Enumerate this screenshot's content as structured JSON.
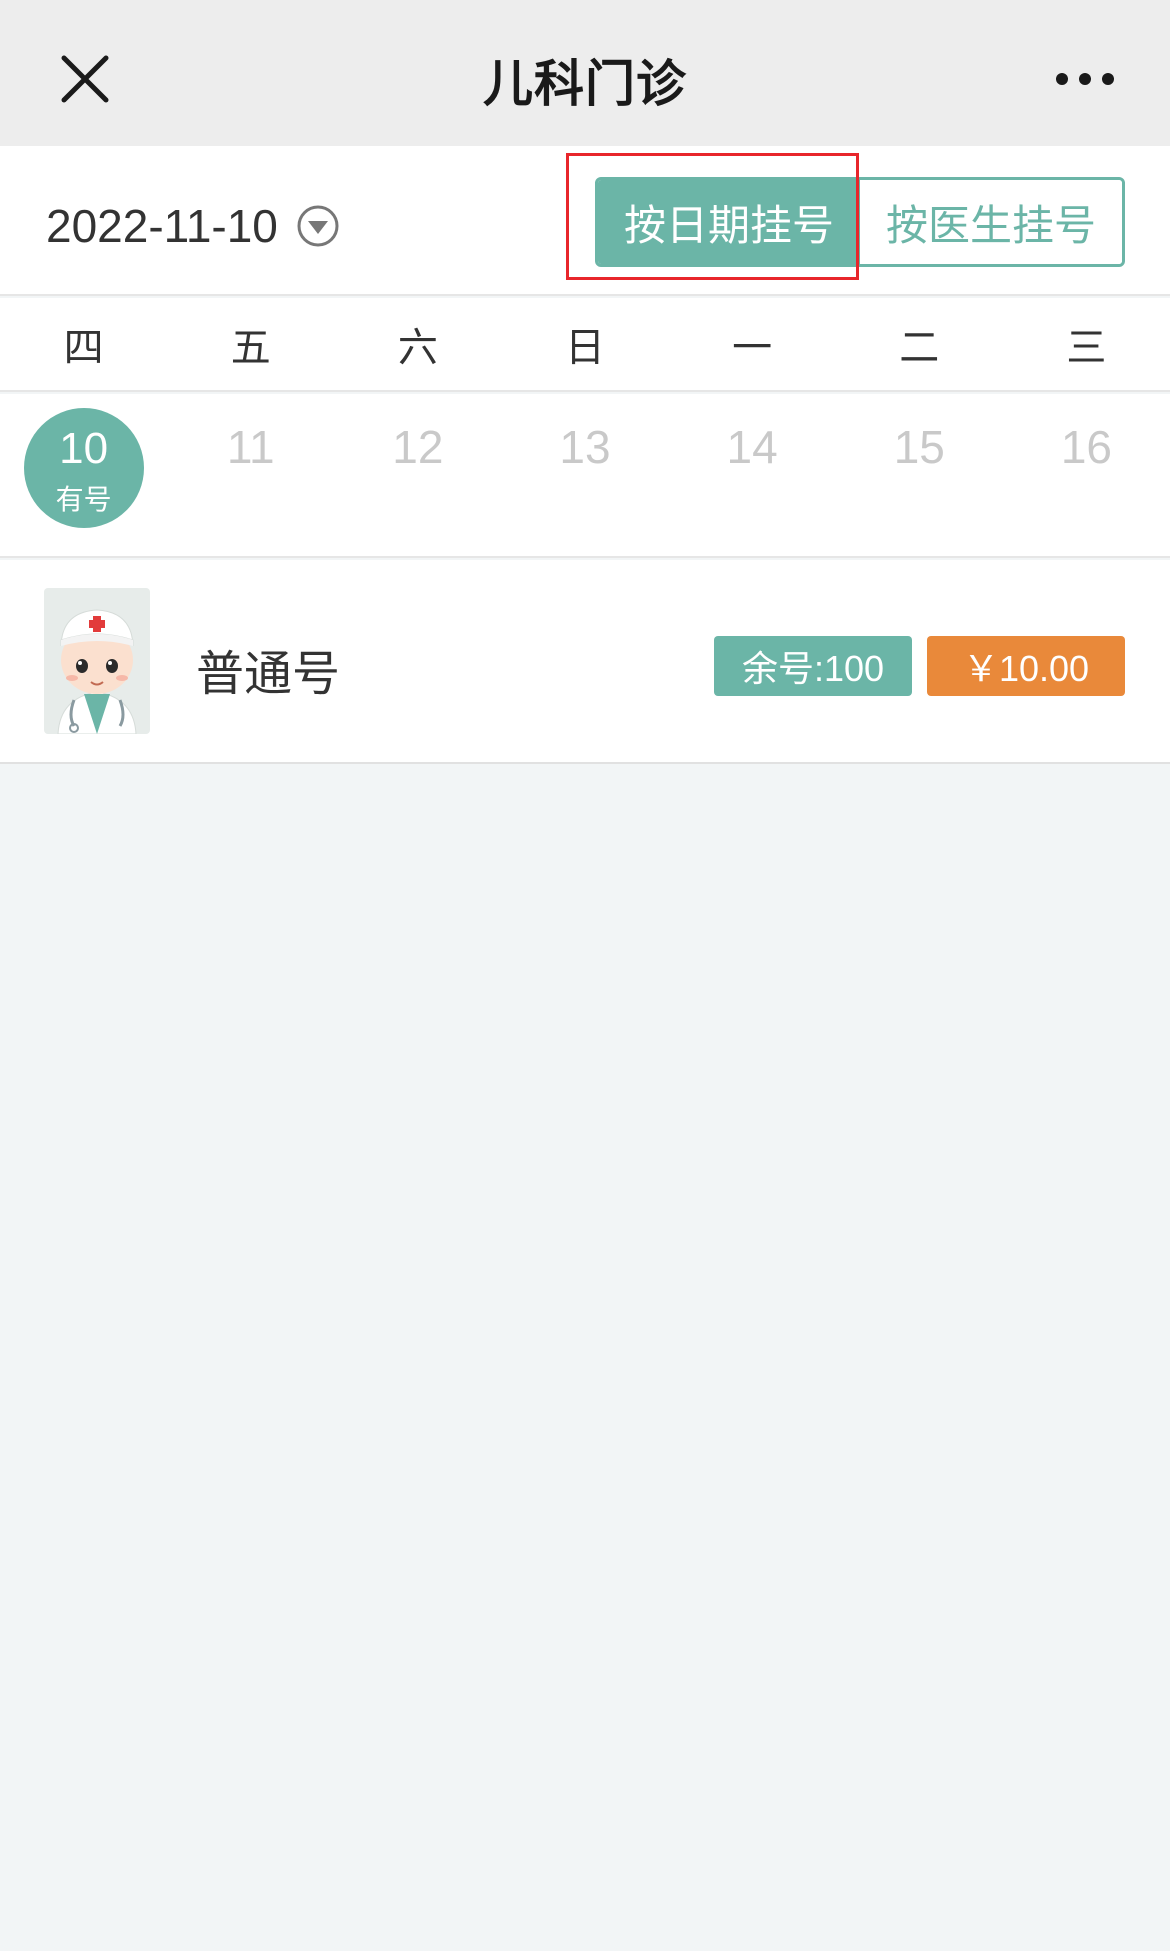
{
  "header": {
    "title": "儿科门诊",
    "close_icon": "close-icon",
    "more_icon": "more-icon"
  },
  "filter": {
    "date": "2022-11-10",
    "dropdown_icon": "chevron-down-circle-icon",
    "tabs": [
      {
        "label": "按日期挂号",
        "active": true
      },
      {
        "label": "按医生挂号",
        "active": false
      }
    ]
  },
  "calendar": {
    "weekdays": [
      "四",
      "五",
      "六",
      "日",
      "一",
      "二",
      "三"
    ],
    "dates": [
      {
        "day": "10",
        "status": "有号",
        "selected": true
      },
      {
        "day": "11",
        "status": "",
        "selected": false
      },
      {
        "day": "12",
        "status": "",
        "selected": false
      },
      {
        "day": "13",
        "status": "",
        "selected": false
      },
      {
        "day": "14",
        "status": "",
        "selected": false
      },
      {
        "day": "15",
        "status": "",
        "selected": false
      },
      {
        "day": "16",
        "status": "",
        "selected": false
      }
    ]
  },
  "schedule": [
    {
      "avatar_icon": "doctor-avatar-icon",
      "name": "普通号",
      "remaining": "余号:100",
      "price": "￥10.00"
    }
  ],
  "colors": {
    "accent": "#6bb5a7",
    "price": "#e9893a",
    "highlight": "#e8262b"
  }
}
